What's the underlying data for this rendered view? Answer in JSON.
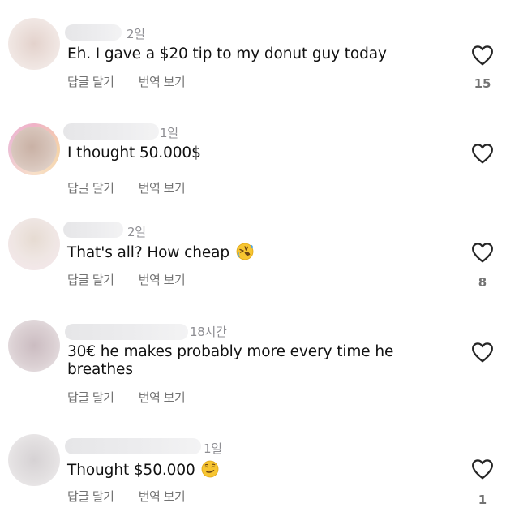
{
  "comments": [
    {
      "time": "2일",
      "text": "Eh. I gave a $20 tip to my donut guy today",
      "reply_label": "답글 달기",
      "translate_label": "번역 보기",
      "likes": "15",
      "emoji": ""
    },
    {
      "time": "1일",
      "text": "I thought 50.000$",
      "reply_label": "답글 달기",
      "translate_label": "번역 보기",
      "likes": "",
      "emoji": ""
    },
    {
      "time": "2일",
      "text": "That's all? How cheap",
      "reply_label": "답글 달기",
      "translate_label": "번역 보기",
      "likes": "8",
      "emoji": "rolling-on-floor-laughing-emoji"
    },
    {
      "time": "18시간",
      "text": "30€ he makes probably more every time he breathes",
      "reply_label": "답글 달기",
      "translate_label": "번역 보기",
      "likes": "",
      "emoji": ""
    },
    {
      "time": "1일",
      "text": "Thought $50.000",
      "reply_label": "답글 달기",
      "translate_label": "번역 보기",
      "likes": "1",
      "emoji": "smirking-face-emoji"
    }
  ],
  "icons": {
    "like": "heart-outline-icon"
  },
  "colors": {
    "text": "#111111",
    "secondary": "#737373",
    "time": "#8e8e93"
  }
}
